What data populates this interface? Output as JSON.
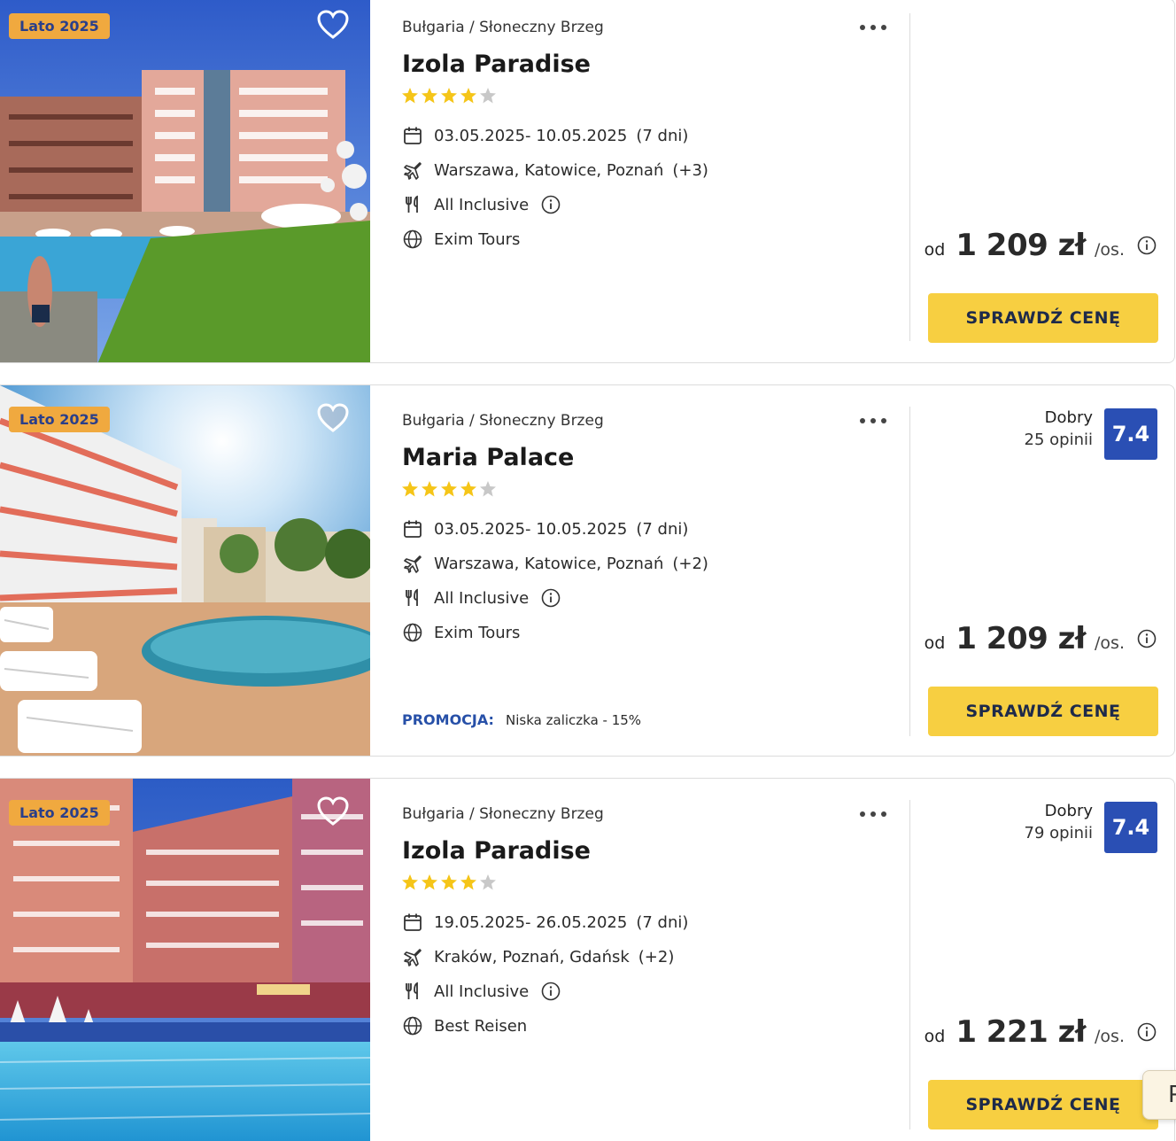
{
  "listings": [
    {
      "season_badge": "Lato 2025",
      "location": "Bułgaria / Słoneczny Brzeg",
      "name": "Izola Paradise",
      "stars": 4,
      "dates": "03.05.2025- 10.05.2025",
      "duration": "(7 dni)",
      "departures": "Warszawa, Katowice, Poznań",
      "departures_more": "(+3)",
      "board": "All Inclusive",
      "operator": "Exim Tours",
      "price_prefix": "od",
      "price": "1 209 zł",
      "price_suffix": "/os.",
      "cta": "SPRAWDŹ CENĘ"
    },
    {
      "season_badge": "Lato 2025",
      "location": "Bułgaria / Słoneczny Brzeg",
      "name": "Maria Palace",
      "stars": 4,
      "dates": "03.05.2025- 10.05.2025",
      "duration": "(7 dni)",
      "departures": "Warszawa, Katowice, Poznań",
      "departures_more": "(+2)",
      "board": "All Inclusive",
      "operator": "Exim Tours",
      "promo_label": "PROMOCJA:",
      "promo_text": "Niska zaliczka - 15%",
      "rating_word": "Dobry",
      "rating_count": "25 opinii",
      "rating_score": "7.4",
      "price_prefix": "od",
      "price": "1 209 zł",
      "price_suffix": "/os.",
      "cta": "SPRAWDŹ CENĘ"
    },
    {
      "season_badge": "Lato 2025",
      "location": "Bułgaria / Słoneczny Brzeg",
      "name": "Izola Paradise",
      "stars": 4,
      "dates": "19.05.2025- 26.05.2025",
      "duration": "(7 dni)",
      "departures": "Kraków, Poznań, Gdańsk",
      "departures_more": "(+2)",
      "board": "All Inclusive",
      "operator": "Best Reisen",
      "rating_word": "Dobry",
      "rating_count": "79 opinii",
      "rating_score": "7.4",
      "price_prefix": "od",
      "price": "1 221 zł",
      "price_suffix": "/os.",
      "cta": "SPRAWDŹ CENĘ"
    }
  ],
  "floating_tab": "P",
  "colors": {
    "badge_bg": "#f0a93f",
    "badge_text": "#2a3f8a",
    "cta_bg": "#f7cf41",
    "rating_bg": "#2a4fb4",
    "promo": "#2750a8",
    "star": "#f5c518"
  },
  "icons": [
    "heart-icon",
    "more-dots-icon",
    "star-icon",
    "calendar-icon",
    "plane-icon",
    "cutlery-icon",
    "info-icon",
    "globe-icon"
  ]
}
